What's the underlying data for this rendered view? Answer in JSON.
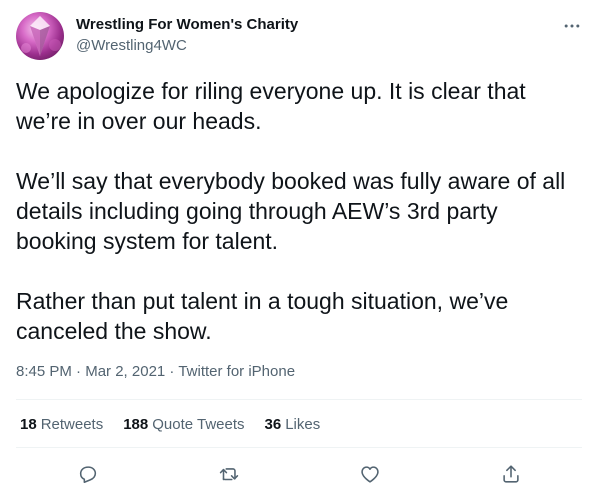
{
  "author": {
    "display_name": "Wrestling For Women's Charity",
    "handle": "@Wrestling4WC",
    "avatar_icon": "avatar-image"
  },
  "tweet": {
    "paragraphs": [
      "We apologize for riling everyone up. It is clear that we’re in over our heads.",
      "We’ll say that everybody booked was fully aware of all details including going through AEW’s 3rd party booking system for talent.",
      "Rather than put talent in a tough situation, we’ve canceled the show."
    ]
  },
  "meta": {
    "time": "8:45 PM",
    "separator": " · ",
    "date": "Mar 2, 2021",
    "source": "Twitter for iPhone"
  },
  "stats": {
    "retweets_count": "18",
    "retweets_label": "Retweets",
    "quote_count": "188",
    "quote_label": "Quote Tweets",
    "likes_count": "36",
    "likes_label": "Likes"
  },
  "actions": {
    "reply_icon": "reply-icon",
    "retweet_icon": "retweet-icon",
    "like_icon": "like-icon",
    "share_icon": "share-icon",
    "more_icon": "more-icon"
  },
  "colors": {
    "text": "#0f1419",
    "secondary": "#536471",
    "divider": "#eff3f4"
  }
}
